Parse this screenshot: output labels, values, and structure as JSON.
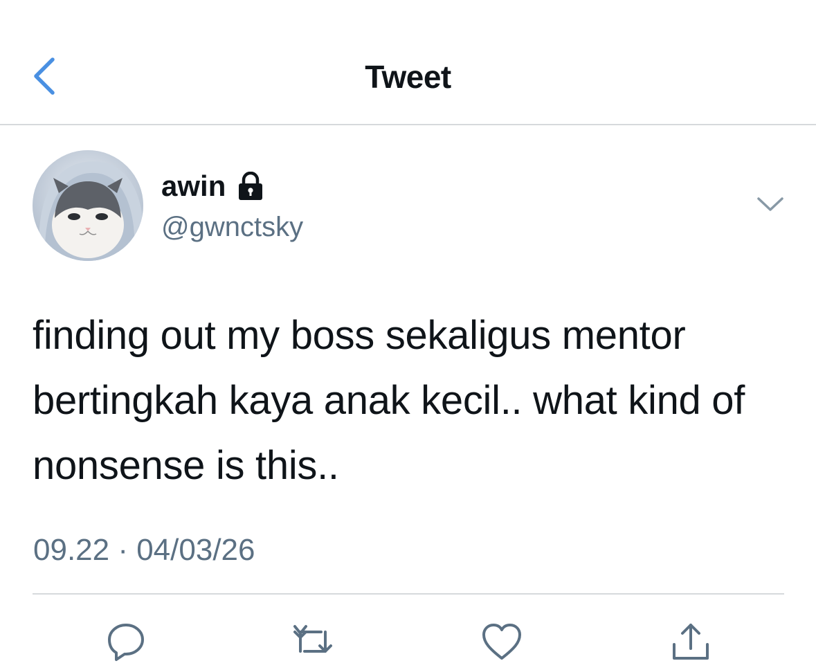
{
  "header": {
    "title": "Tweet",
    "back_icon": "chevron-left-icon",
    "accent_color": "#4a90e2"
  },
  "tweet": {
    "author": {
      "display_name": "awin",
      "handle": "@gwnctsky",
      "protected_icon": "lock-icon",
      "avatar": "avatar"
    },
    "text": "finding out my boss sekaligus mentor bertingkah kaya anak kecil.. what kind of nonsense is this..",
    "timestamp": "09.22 · 04/03/26",
    "menu_icon": "chevron-down-icon"
  },
  "actions": [
    {
      "name": "reply",
      "icon": "reply-icon"
    },
    {
      "name": "retweet",
      "icon": "retweet-icon"
    },
    {
      "name": "like",
      "icon": "heart-icon"
    },
    {
      "name": "share",
      "icon": "share-icon"
    }
  ],
  "colors": {
    "text": "#0f1419",
    "secondary": "#5b7083",
    "divider": "#d6d9dc"
  }
}
